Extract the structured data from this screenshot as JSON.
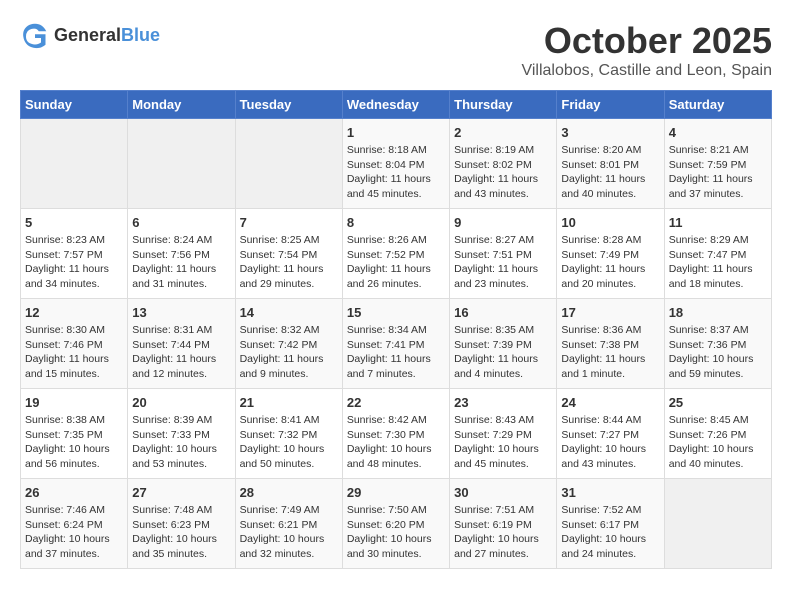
{
  "header": {
    "logo_general": "General",
    "logo_blue": "Blue",
    "month": "October 2025",
    "location": "Villalobos, Castille and Leon, Spain"
  },
  "days_of_week": [
    "Sunday",
    "Monday",
    "Tuesday",
    "Wednesday",
    "Thursday",
    "Friday",
    "Saturday"
  ],
  "weeks": [
    [
      {
        "day": "",
        "info": ""
      },
      {
        "day": "",
        "info": ""
      },
      {
        "day": "",
        "info": ""
      },
      {
        "day": "1",
        "info": "Sunrise: 8:18 AM\nSunset: 8:04 PM\nDaylight: 11 hours and 45 minutes."
      },
      {
        "day": "2",
        "info": "Sunrise: 8:19 AM\nSunset: 8:02 PM\nDaylight: 11 hours and 43 minutes."
      },
      {
        "day": "3",
        "info": "Sunrise: 8:20 AM\nSunset: 8:01 PM\nDaylight: 11 hours and 40 minutes."
      },
      {
        "day": "4",
        "info": "Sunrise: 8:21 AM\nSunset: 7:59 PM\nDaylight: 11 hours and 37 minutes."
      }
    ],
    [
      {
        "day": "5",
        "info": "Sunrise: 8:23 AM\nSunset: 7:57 PM\nDaylight: 11 hours and 34 minutes."
      },
      {
        "day": "6",
        "info": "Sunrise: 8:24 AM\nSunset: 7:56 PM\nDaylight: 11 hours and 31 minutes."
      },
      {
        "day": "7",
        "info": "Sunrise: 8:25 AM\nSunset: 7:54 PM\nDaylight: 11 hours and 29 minutes."
      },
      {
        "day": "8",
        "info": "Sunrise: 8:26 AM\nSunset: 7:52 PM\nDaylight: 11 hours and 26 minutes."
      },
      {
        "day": "9",
        "info": "Sunrise: 8:27 AM\nSunset: 7:51 PM\nDaylight: 11 hours and 23 minutes."
      },
      {
        "day": "10",
        "info": "Sunrise: 8:28 AM\nSunset: 7:49 PM\nDaylight: 11 hours and 20 minutes."
      },
      {
        "day": "11",
        "info": "Sunrise: 8:29 AM\nSunset: 7:47 PM\nDaylight: 11 hours and 18 minutes."
      }
    ],
    [
      {
        "day": "12",
        "info": "Sunrise: 8:30 AM\nSunset: 7:46 PM\nDaylight: 11 hours and 15 minutes."
      },
      {
        "day": "13",
        "info": "Sunrise: 8:31 AM\nSunset: 7:44 PM\nDaylight: 11 hours and 12 minutes."
      },
      {
        "day": "14",
        "info": "Sunrise: 8:32 AM\nSunset: 7:42 PM\nDaylight: 11 hours and 9 minutes."
      },
      {
        "day": "15",
        "info": "Sunrise: 8:34 AM\nSunset: 7:41 PM\nDaylight: 11 hours and 7 minutes."
      },
      {
        "day": "16",
        "info": "Sunrise: 8:35 AM\nSunset: 7:39 PM\nDaylight: 11 hours and 4 minutes."
      },
      {
        "day": "17",
        "info": "Sunrise: 8:36 AM\nSunset: 7:38 PM\nDaylight: 11 hours and 1 minute."
      },
      {
        "day": "18",
        "info": "Sunrise: 8:37 AM\nSunset: 7:36 PM\nDaylight: 10 hours and 59 minutes."
      }
    ],
    [
      {
        "day": "19",
        "info": "Sunrise: 8:38 AM\nSunset: 7:35 PM\nDaylight: 10 hours and 56 minutes."
      },
      {
        "day": "20",
        "info": "Sunrise: 8:39 AM\nSunset: 7:33 PM\nDaylight: 10 hours and 53 minutes."
      },
      {
        "day": "21",
        "info": "Sunrise: 8:41 AM\nSunset: 7:32 PM\nDaylight: 10 hours and 50 minutes."
      },
      {
        "day": "22",
        "info": "Sunrise: 8:42 AM\nSunset: 7:30 PM\nDaylight: 10 hours and 48 minutes."
      },
      {
        "day": "23",
        "info": "Sunrise: 8:43 AM\nSunset: 7:29 PM\nDaylight: 10 hours and 45 minutes."
      },
      {
        "day": "24",
        "info": "Sunrise: 8:44 AM\nSunset: 7:27 PM\nDaylight: 10 hours and 43 minutes."
      },
      {
        "day": "25",
        "info": "Sunrise: 8:45 AM\nSunset: 7:26 PM\nDaylight: 10 hours and 40 minutes."
      }
    ],
    [
      {
        "day": "26",
        "info": "Sunrise: 7:46 AM\nSunset: 6:24 PM\nDaylight: 10 hours and 37 minutes."
      },
      {
        "day": "27",
        "info": "Sunrise: 7:48 AM\nSunset: 6:23 PM\nDaylight: 10 hours and 35 minutes."
      },
      {
        "day": "28",
        "info": "Sunrise: 7:49 AM\nSunset: 6:21 PM\nDaylight: 10 hours and 32 minutes."
      },
      {
        "day": "29",
        "info": "Sunrise: 7:50 AM\nSunset: 6:20 PM\nDaylight: 10 hours and 30 minutes."
      },
      {
        "day": "30",
        "info": "Sunrise: 7:51 AM\nSunset: 6:19 PM\nDaylight: 10 hours and 27 minutes."
      },
      {
        "day": "31",
        "info": "Sunrise: 7:52 AM\nSunset: 6:17 PM\nDaylight: 10 hours and 24 minutes."
      },
      {
        "day": "",
        "info": ""
      }
    ]
  ]
}
